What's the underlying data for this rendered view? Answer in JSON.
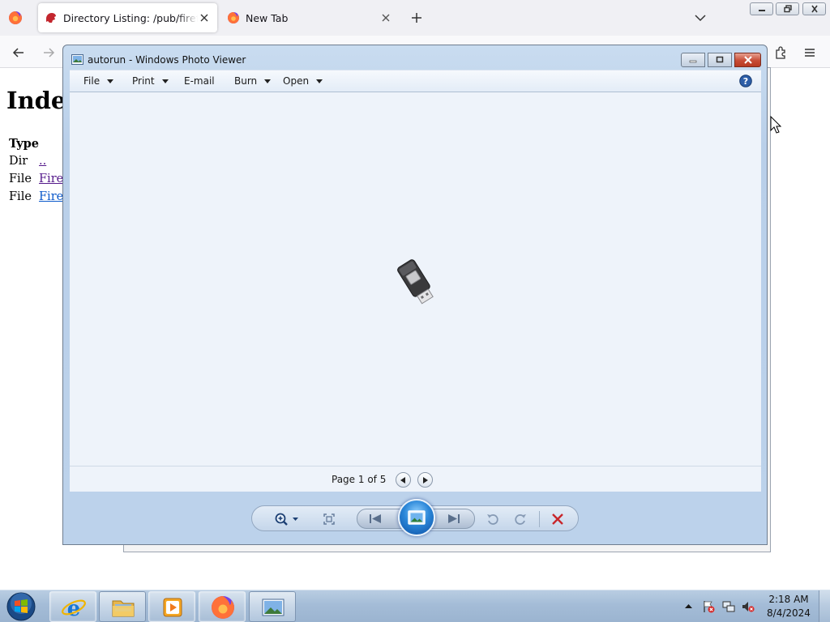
{
  "browser": {
    "tabs": [
      {
        "title": "Directory Listing: /pub/firefox/r",
        "active": true
      },
      {
        "title": "New Tab",
        "active": false
      }
    ],
    "page": {
      "heading": "Index",
      "table_header": "Type",
      "rows": [
        {
          "type": "Dir",
          "link": ".."
        },
        {
          "type": "File",
          "link": "Firef"
        },
        {
          "type": "File",
          "link": "Firef"
        }
      ]
    }
  },
  "photo_viewer": {
    "title": "autorun - Windows Photo Viewer",
    "menu": {
      "file": "File",
      "print": "Print",
      "email": "E-mail",
      "burn": "Burn",
      "open": "Open"
    },
    "page_label": "Page 1 of 5",
    "image_icon": "usb-flash-drive-icon"
  },
  "taskbar": {
    "apps": [
      "internet-explorer-icon",
      "windows-explorer-icon",
      "media-player-icon",
      "firefox-icon",
      "photo-viewer-icon"
    ],
    "clock": {
      "time": "2:18 AM",
      "date": "8/4/2024"
    }
  },
  "colors": {
    "viewer_chrome": "#bcd2eb",
    "viewer_canvas": "#eef3fa",
    "delete_red": "#c8262b",
    "visited_link": "#551a8b",
    "link": "#0a58ca"
  }
}
